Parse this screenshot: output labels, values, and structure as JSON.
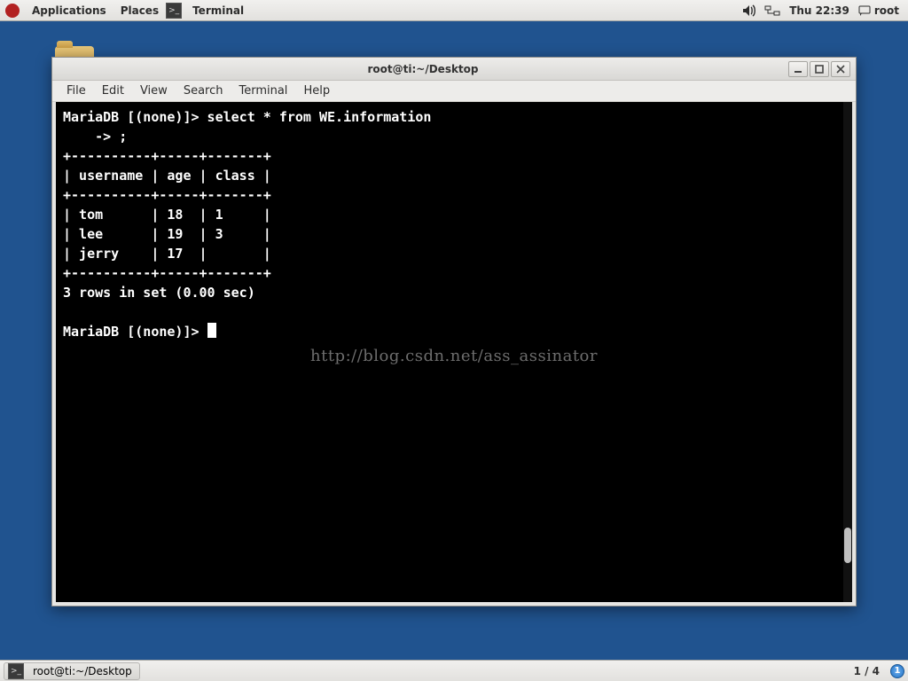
{
  "topbar": {
    "applications": "Applications",
    "places": "Places",
    "task_label": "Terminal",
    "clock": "Thu 22:39",
    "user": "root"
  },
  "window": {
    "title": "root@ti:~/Desktop",
    "menus": {
      "file": "File",
      "edit": "Edit",
      "view": "View",
      "search": "Search",
      "terminal": "Terminal",
      "help": "Help"
    }
  },
  "terminal": {
    "prompt1": "MariaDB [(none)]> select * from WE.information",
    "cont": "    -> ;",
    "divider": "+----------+-----+-------+",
    "header": "| username | age | class |",
    "row1": "| tom      | 18  | 1     |",
    "row2": "| lee      | 19  | 3     |",
    "row3": "| jerry    | 17  |       |",
    "summary": "3 rows in set (0.00 sec)",
    "prompt2": "MariaDB [(none)]> ",
    "watermark": "http://blog.csdn.net/ass_assinator"
  },
  "query_result": {
    "columns": [
      "username",
      "age",
      "class"
    ],
    "rows": [
      {
        "username": "tom",
        "age": 18,
        "class": "1"
      },
      {
        "username": "lee",
        "age": 19,
        "class": "3"
      },
      {
        "username": "jerry",
        "age": 17,
        "class": ""
      }
    ],
    "rows_in_set": 3,
    "elapsed_sec": 0.0
  },
  "bottombar": {
    "task": "root@ti:~/Desktop",
    "pager": "1 / 4",
    "update_badge": "1"
  }
}
